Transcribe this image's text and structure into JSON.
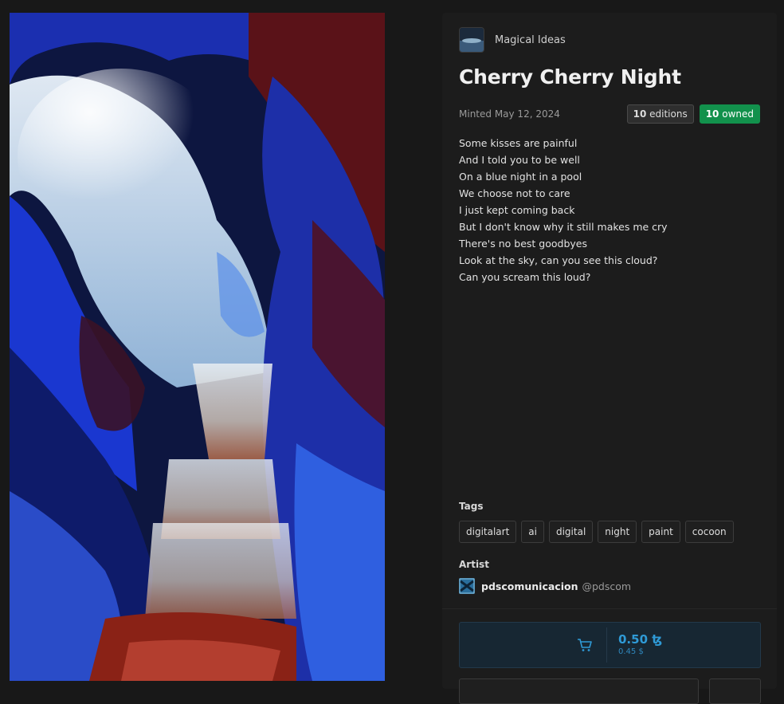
{
  "collection": {
    "name": "Magical Ideas"
  },
  "token": {
    "title": "Cherry Cherry Night",
    "minted": "Minted May 12, 2024",
    "editions_count": "10",
    "editions_label": "editions",
    "owned_count": "10",
    "owned_label": "owned"
  },
  "description": [
    "Some kisses are painful",
    "And I told you to be well",
    "On a blue night in a pool",
    "We choose not to care",
    "I just kept coming back",
    "But I don't know why it still makes me cry",
    "There's no best goodbyes",
    "Look at the sky, can you see this cloud?",
    "Can you scream this loud?"
  ],
  "tags_title": "Tags",
  "tags": [
    "digitalart",
    "ai",
    "digital",
    "night",
    "paint",
    "cocoon"
  ],
  "artist": {
    "section_title": "Artist",
    "name": "pdscomunicacion",
    "handle": "@pdscom"
  },
  "purchase": {
    "price": "0.50 ꜩ",
    "price_usd": "0.45 $",
    "icon": "cart-icon"
  },
  "colors": {
    "background": "#181818",
    "panel": "#1c1c1c",
    "owned_badge": "#12914c",
    "price_accent": "#2f9ad6"
  }
}
